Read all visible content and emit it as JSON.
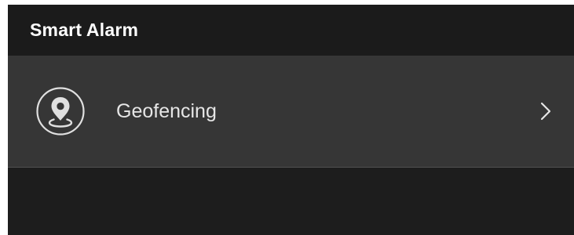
{
  "header": {
    "title": "Smart Alarm"
  },
  "settings": {
    "items": [
      {
        "label": "Geofencing",
        "icon": "location-pin-icon",
        "trailing_icon": "chevron-right-icon"
      }
    ]
  },
  "colors": {
    "header_background": "#1b1b1b",
    "row_background": "#363636",
    "text_primary": "#ffffff",
    "text_secondary": "#e6e6e6",
    "icon_color": "#e0e0e0"
  }
}
